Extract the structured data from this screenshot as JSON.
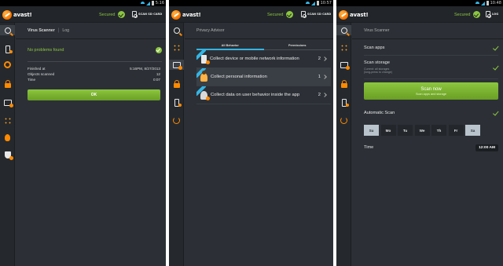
{
  "colors": {
    "accent_green": "#8cc63f",
    "accent_blue": "#33b5e5",
    "accent_orange": "#ff8a00",
    "bg": "#2c3036"
  },
  "screens": [
    {
      "status_time": "5:16",
      "app_logo": "avast!",
      "secured_label": "Secured",
      "sd_label": "SCAN SD CARD",
      "header_tab": "Virus Scanner",
      "header_sep": "|",
      "header_tab2": "Log",
      "result": "No problems found",
      "stats": [
        {
          "label": "Finished at",
          "value": "5:16PM, 8/27/2013"
        },
        {
          "label": "Objects scanned",
          "value": "12"
        },
        {
          "label": "Time",
          "value": "0:07"
        }
      ],
      "ok_button": "OK"
    },
    {
      "status_time": "10:57",
      "app_logo": "avast!",
      "secured_label": "Secured",
      "sd_label": "SCAN SD CARD",
      "header_title": "Privacy Advisor",
      "tabs": [
        "All Behavior",
        "Permissions"
      ],
      "rows": [
        {
          "text": "Collect device or mobile network information",
          "count": "2",
          "icon": "phone-icon"
        },
        {
          "text": "Collect personal information",
          "count": "1",
          "icon": "person-icon"
        },
        {
          "text": "Collect data on user behavior inside the app",
          "count": "2",
          "icon": "user-icon"
        }
      ]
    },
    {
      "status_time": "10:48",
      "app_logo": "avast!",
      "secured_label": "Secured",
      "sd_label": "LOG",
      "header_title": "Virus Scanner",
      "scan_apps": "Scan apps",
      "scan_storage": "Scan storage",
      "scan_storage_sub1": "Current: all storages",
      "scan_storage_sub2": "(long-press to change)",
      "scan_now": "Scan now",
      "scan_now_sub": "Scan apps and storage",
      "auto_scan": "Automatic Scan",
      "days": [
        "Su",
        "Mo",
        "Tu",
        "We",
        "Th",
        "Fr",
        "Sa"
      ],
      "days_selected": [
        "Su",
        "Sa"
      ],
      "time_label": "Time",
      "time_value": "12:00 AM"
    }
  ]
}
